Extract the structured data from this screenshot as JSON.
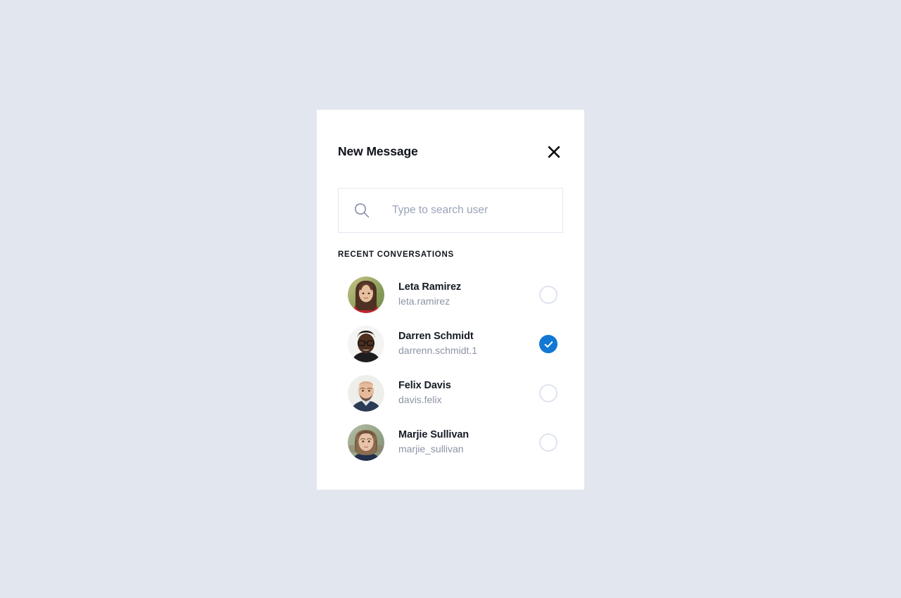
{
  "page": {
    "background_color": "#e2e6ee"
  },
  "modal": {
    "title": "New Message",
    "close_icon": "close-x-icon",
    "surface_color": "#ffffff"
  },
  "search": {
    "icon": "search-icon",
    "value": "",
    "placeholder": "Type to search user",
    "border_color": "#e3e8f0"
  },
  "list": {
    "section_label": "RECENT CONVERSATIONS",
    "selected_color": "#1278d4",
    "unselected_ring_color": "#dfe4ee",
    "users": [
      {
        "name": "Leta Ramirez",
        "handle": "leta.ramirez",
        "selected": false,
        "avatar_name": "avatar-leta-ramirez"
      },
      {
        "name": "Darren Schmidt",
        "handle": "darrenn.schmidt.1",
        "selected": true,
        "avatar_name": "avatar-darren-schmidt"
      },
      {
        "name": "Felix Davis",
        "handle": "davis.felix",
        "selected": false,
        "avatar_name": "avatar-felix-davis"
      },
      {
        "name": "Marjie Sullivan",
        "handle": "marjie_sullivan",
        "selected": false,
        "avatar_name": "avatar-marjie-sullivan"
      }
    ]
  }
}
